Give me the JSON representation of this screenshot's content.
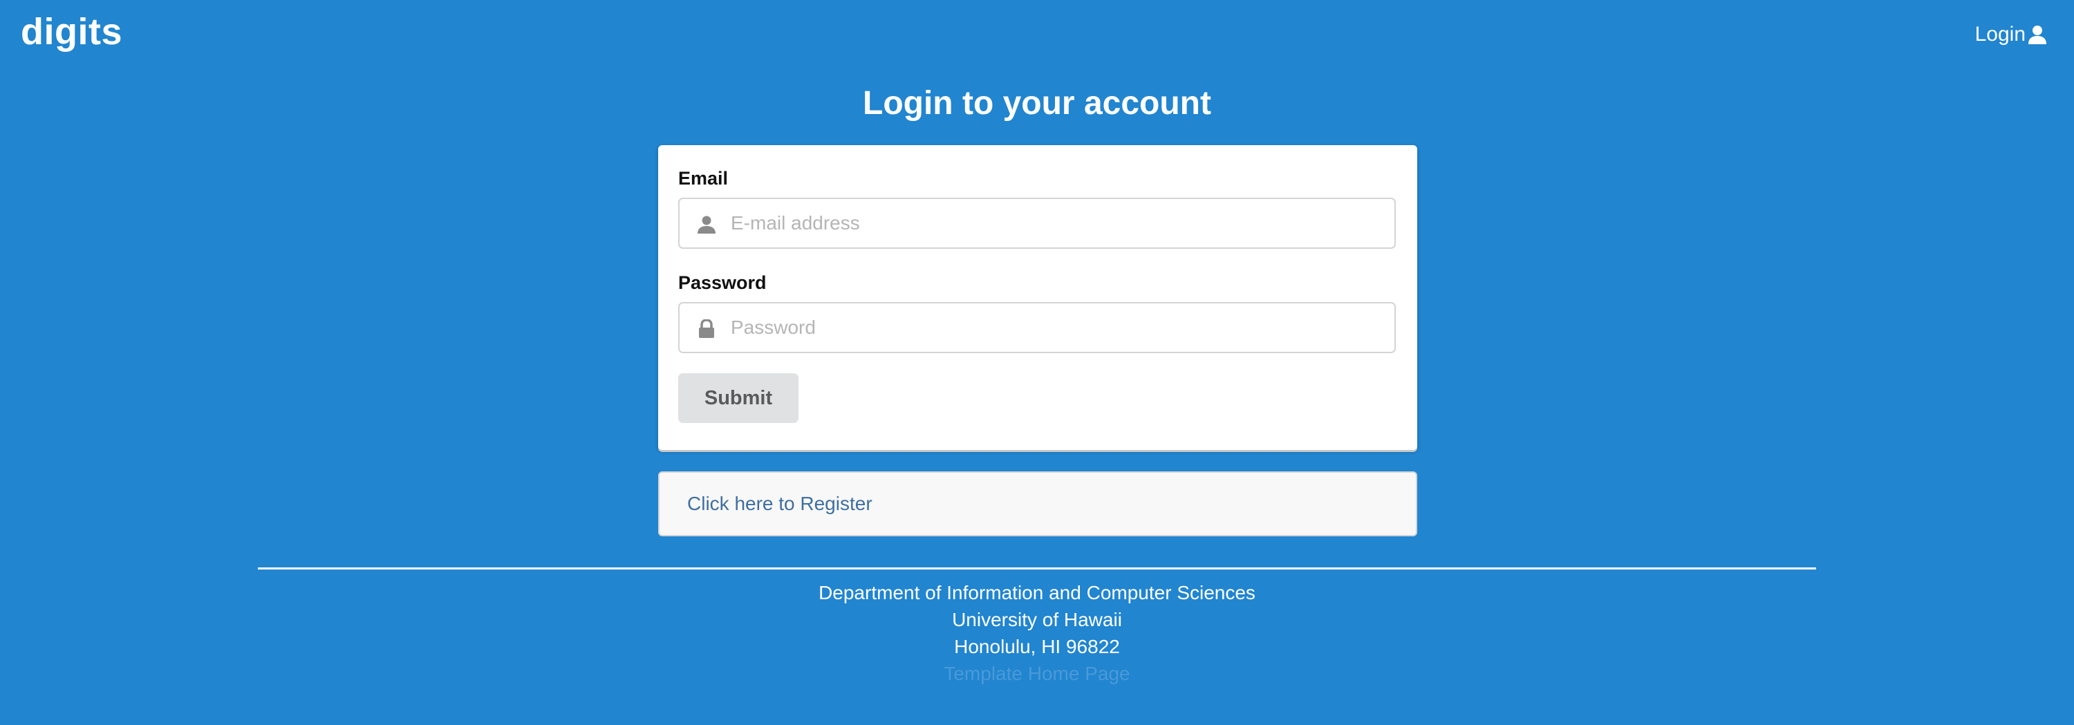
{
  "navbar": {
    "brand": "digits",
    "login_label": "Login",
    "login_icon": "user-icon"
  },
  "page": {
    "title": "Login to your account"
  },
  "login_form": {
    "email_label": "Email",
    "email_placeholder": "E-mail address",
    "email_value": "",
    "email_icon": "user-icon",
    "password_label": "Password",
    "password_placeholder": "Password",
    "password_value": "",
    "password_icon": "lock-icon",
    "submit_label": "Submit"
  },
  "register": {
    "link_label": "Click here to Register"
  },
  "footer": {
    "line1": "Department of Information and Computer Sciences",
    "line2": "University of Hawaii",
    "line3": "Honolulu, HI 96822",
    "homepage_link": "Template Home Page"
  },
  "colors": {
    "background": "#2185d0",
    "card": "#ffffff",
    "button": "#e0e1e2",
    "register_bg": "#f8f8f9",
    "link": "#3f6f9f"
  }
}
